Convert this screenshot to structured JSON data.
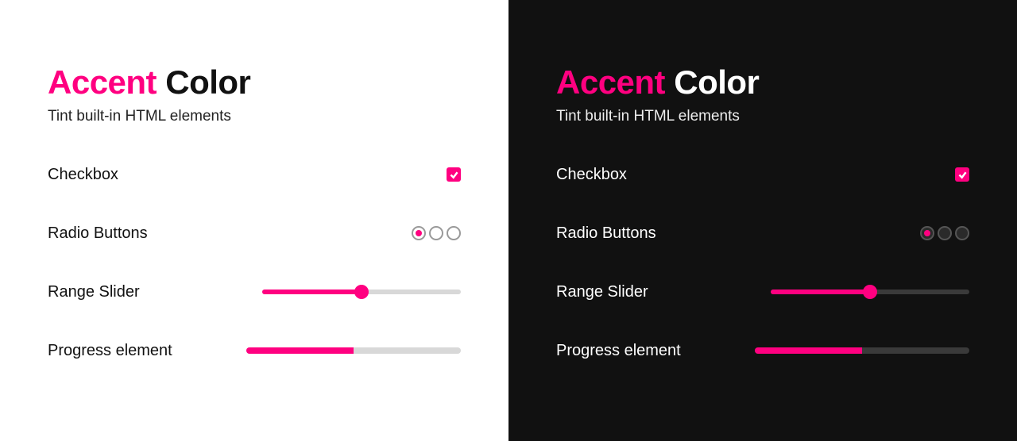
{
  "accent_color": "#ff0080",
  "title": {
    "accent": "Accent",
    "rest": "Color"
  },
  "subtitle": "Tint built-in HTML elements",
  "rows": {
    "checkbox_label": "Checkbox",
    "radio_label": "Radio Buttons",
    "range_label": "Range Slider",
    "progress_label": "Progress element"
  },
  "checkbox_checked": true,
  "radio_selected_index": 0,
  "range_value": 50,
  "range_min": 0,
  "range_max": 100,
  "progress_value": 50,
  "progress_max": 100
}
